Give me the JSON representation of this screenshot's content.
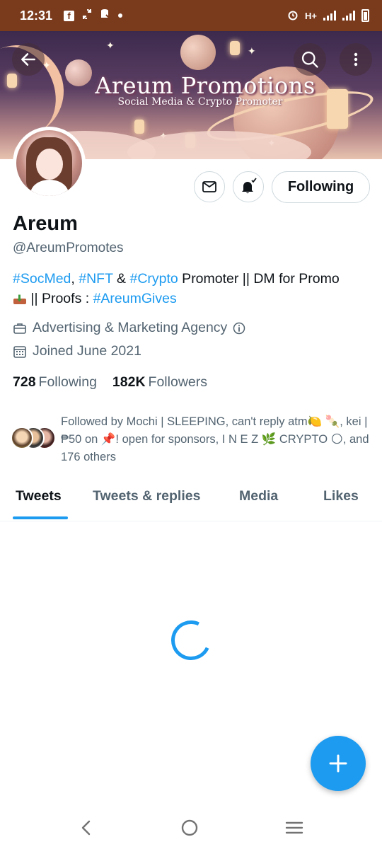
{
  "status_bar": {
    "time": "12:31",
    "network": "H+"
  },
  "header": {
    "banner_title": "Areum Promotions",
    "banner_subtitle": "Social Media & Crypto Promoter",
    "back_icon": "arrow-left-icon",
    "search_icon": "search-icon",
    "more_icon": "more-vertical-icon"
  },
  "profile": {
    "name": "Areum",
    "handle": "@AreumPromotes",
    "bio": {
      "tag1": "#SocMed",
      "sep1": ", ",
      "tag2": "#NFT",
      "sep2": " & ",
      "tag3": "#Crypto",
      "text1": " Promoter || DM for Promo",
      "text2": " || Proofs : ",
      "tag4": "#AreumGives"
    },
    "category": "Advertising & Marketing Agency",
    "joined": "Joined June 2021",
    "following_count": "728",
    "following_label": "Following",
    "followers_count": "182K",
    "followers_label": "Followers",
    "followed_by": "Followed by Mochi | SLEEPING, can't reply atm🍋 🍡, kei | ₱50 on 📌! open for sponsors, I N E Z 🌿 CRYPTO 🌕, and 176 others"
  },
  "actions": {
    "following_button": "Following",
    "message_icon": "mail-icon",
    "notify_icon": "bell-check-icon"
  },
  "tabs": [
    {
      "label": "Tweets",
      "active": true
    },
    {
      "label": "Tweets & replies",
      "active": false
    },
    {
      "label": "Media",
      "active": false
    },
    {
      "label": "Likes",
      "active": false
    }
  ],
  "colors": {
    "accent": "#1d9bf0",
    "status_bar": "#7a3a1c",
    "text_primary": "#0f1419",
    "text_secondary": "#536471"
  }
}
